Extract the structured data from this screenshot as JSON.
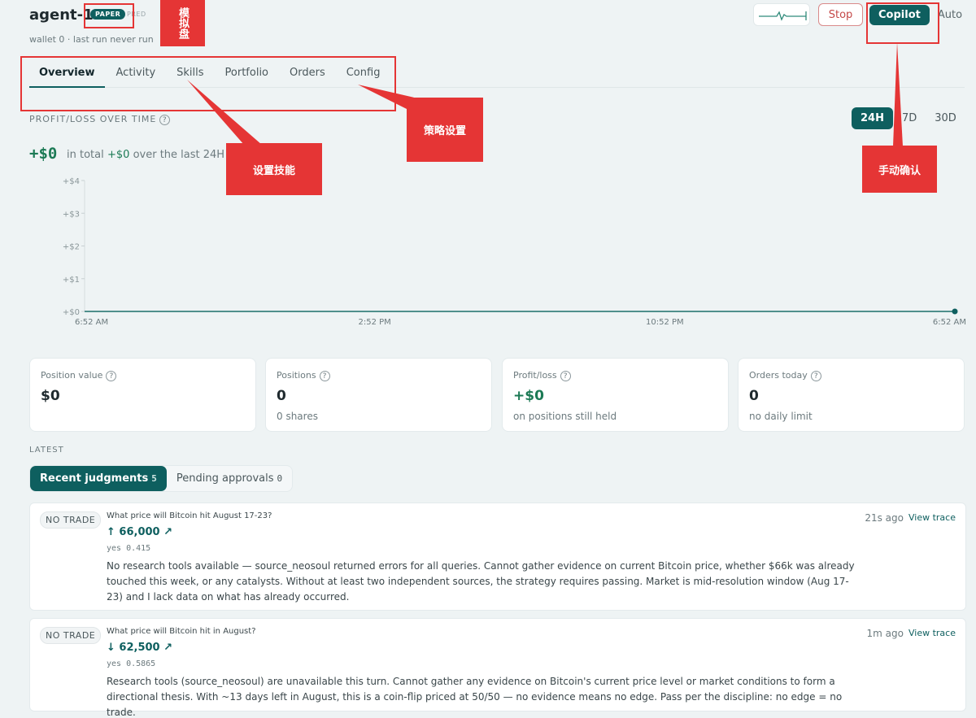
{
  "agent": {
    "name": "agent-1",
    "badge": "PAPER",
    "mode_hint": "PRED",
    "subtitle": "wallet 0 · last run never run"
  },
  "controls": {
    "stop_label": "Stop",
    "copilot_label": "Copilot",
    "auto_label": "Auto"
  },
  "tabs": [
    {
      "label": "Overview"
    },
    {
      "label": "Activity"
    },
    {
      "label": "Skills"
    },
    {
      "label": "Portfolio"
    },
    {
      "label": "Orders"
    },
    {
      "label": "Config"
    }
  ],
  "pnl": {
    "section_label": "PROFIT/LOSS OVER TIME",
    "ranges": [
      "24H",
      "7D",
      "30D"
    ],
    "total": "+$0",
    "total_suffix": "in total",
    "last_value": "+$0",
    "last_suffix": "over the last 24H"
  },
  "chart_data": {
    "type": "line",
    "x": [
      "6:52 AM",
      "2:52 PM",
      "10:52 PM",
      "6:52 AM"
    ],
    "y_ticks": [
      "+$0",
      "+$1",
      "+$2",
      "+$3",
      "+$4"
    ],
    "ylim": [
      0,
      4
    ],
    "series": [
      {
        "values": [
          0,
          0,
          0,
          0
        ]
      }
    ],
    "grid": false,
    "color": "#4f8f8c"
  },
  "stats": [
    {
      "label": "Position value",
      "value": "$0",
      "sub": ""
    },
    {
      "label": "Positions",
      "value": "0",
      "sub": "0 shares"
    },
    {
      "label": "Profit/loss",
      "value": "+$0",
      "sub": "on positions still held"
    },
    {
      "label": "Orders today",
      "value": "0",
      "sub": "no daily limit"
    }
  ],
  "latest": {
    "label": "LATEST",
    "tab_recent": "Recent judgments",
    "tab_recent_count": "5",
    "tab_pending": "Pending approvals",
    "tab_pending_count": "0"
  },
  "judgments": [
    {
      "badge": "NO TRADE",
      "question": "What price will Bitcoin hit August 17-23?",
      "price": "↑ 66,000 ↗",
      "yes": "yes 0.415",
      "body": "No research tools available — source_neosoul returned errors for all queries. Cannot gather evidence on current Bitcoin price, whether $66k was already touched this week, or any catalysts. Without at least two independent sources, the strategy requires passing. Market is mid-resolution window (Aug 17-23) and I lack data on what has already occurred.",
      "time": "21s ago",
      "trace": "View trace"
    },
    {
      "badge": "NO TRADE",
      "question": "What price will Bitcoin hit in August?",
      "price": "↓ 62,500 ↗",
      "yes": "yes 0.5865",
      "body": "Research tools (source_neosoul) are unavailable this turn. Cannot gather any evidence on Bitcoin's current price level or market conditions to form a directional thesis. With ~13 days left in August, this is a coin-flip priced at 50/50 — no evidence means no edge. Pass per the discipline: no edge = no trade.",
      "time": "1m ago",
      "trace": "View trace"
    }
  ],
  "annotations": {
    "paper": "模拟盘",
    "skills": "设置技能",
    "strategy": "策略设置",
    "manual": "手动确认"
  },
  "colors": {
    "accent": "#0e5f5f",
    "positive": "#1c7a55",
    "danger": "#c44848",
    "annotation": "#e53535"
  }
}
